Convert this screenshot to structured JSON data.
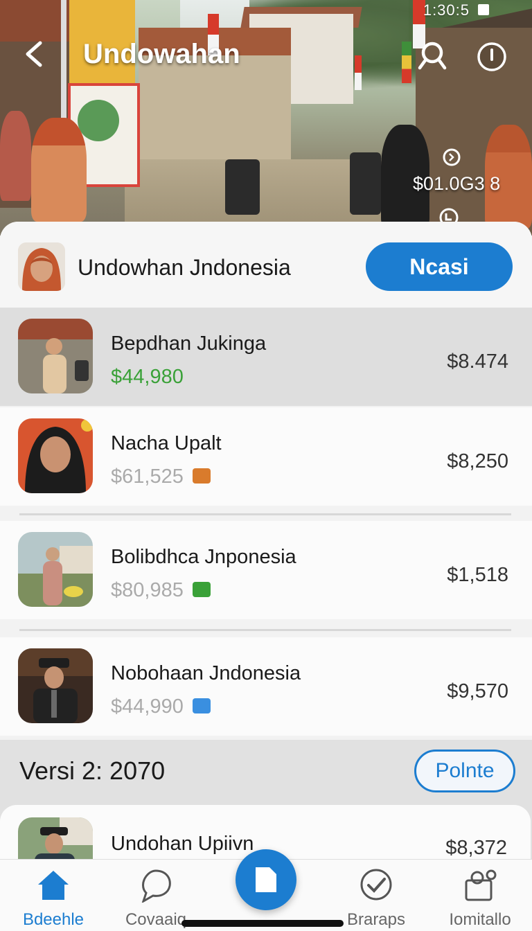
{
  "status": {
    "time": "1:30:5"
  },
  "nav": {
    "title": "Undowahan"
  },
  "hero": {
    "amount": "$01.0G3 8"
  },
  "header": {
    "title": "Undowhan Jndonesia",
    "button_label": "Ncasi"
  },
  "items": [
    {
      "name": "Bepdhan Jukinga",
      "price": "$44,980",
      "value": "$8.474"
    },
    {
      "name": "Nacha Upalt",
      "price": "$61,525",
      "value": "$8,250"
    },
    {
      "name": "Bolibdhca Jnponesia",
      "price": "$80,985",
      "value": "$1,518"
    },
    {
      "name": "Nobohaan Jndonesia",
      "price": "$44,990",
      "value": "$9,570"
    }
  ],
  "section": {
    "title": "Versi 2: 2070",
    "button_label": "Polnte"
  },
  "card": {
    "name": "Undohan Upiivn",
    "value": "$8,372"
  },
  "tabs": [
    {
      "label": "Bdeehle",
      "icon": "home-icon"
    },
    {
      "label": "Covaaiq",
      "icon": "chat-bubble-icon"
    },
    {
      "label": "Braraps",
      "icon": "check-circle-icon"
    },
    {
      "label": "Iomitallo",
      "icon": "profile-icon"
    }
  ],
  "colors": {
    "accent": "#1c7dd0",
    "positive": "#3aa138",
    "tag_orange": "#d97b2c",
    "tag_green": "#3aa138",
    "tag_blue": "#3a8fe0"
  }
}
